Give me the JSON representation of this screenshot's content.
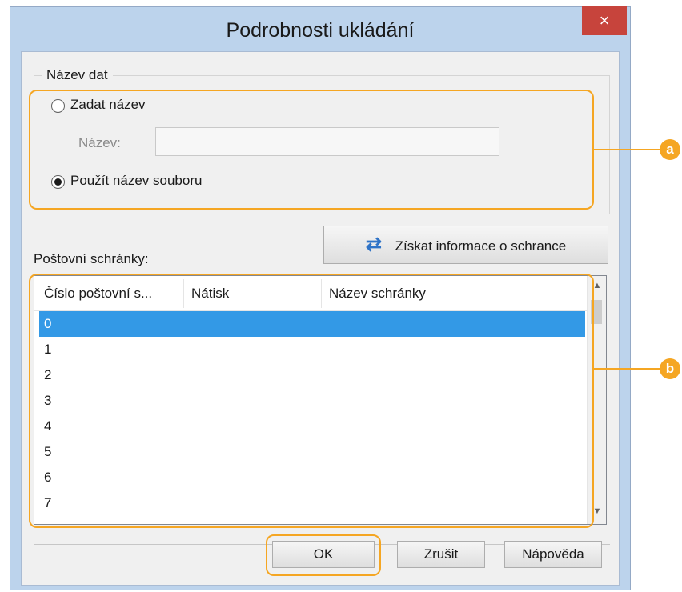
{
  "window": {
    "title": "Podrobnosti ukládání",
    "close_glyph": "×"
  },
  "data_name_group": {
    "legend": "Název dat",
    "option_enter_name": "Zadat název",
    "name_label": "Název:",
    "name_value": "",
    "option_use_filename": "Použít název souboru",
    "selected_option": "Použít název souboru"
  },
  "mailbox": {
    "get_info_button": "Získat informace o schrance",
    "list_label": "Poštovní schránky:",
    "columns": [
      "Číslo poštovní s...",
      "Nátisk",
      "Název schránky"
    ],
    "rows": [
      "0",
      "1",
      "2",
      "3",
      "4",
      "5",
      "6",
      "7"
    ],
    "selected_row": "0"
  },
  "buttons": {
    "ok": "OK",
    "cancel": "Zrušit",
    "help": "Nápověda"
  },
  "callouts": {
    "a": "a",
    "b": "b"
  },
  "icons": {
    "refresh": "refresh-icon",
    "close": "close-icon"
  },
  "colors": {
    "highlight": "#f5a623",
    "selection": "#3399e6",
    "close_button": "#c7443c"
  }
}
